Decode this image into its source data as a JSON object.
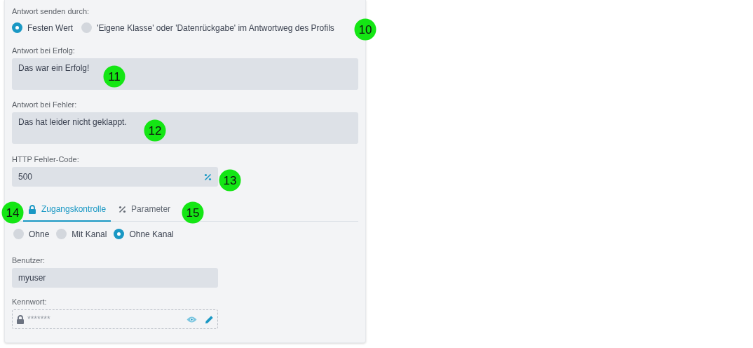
{
  "send_via": {
    "label": "Antwort senden durch:",
    "options": [
      {
        "label": "Festen Wert",
        "selected": true
      },
      {
        "label": "'Eigene Klasse' oder 'Datenrückgabe' im Antwortweg des Profils",
        "selected": false
      }
    ]
  },
  "success": {
    "label": "Antwort bei Erfolg:",
    "value": "Das war ein Erfolg!"
  },
  "error": {
    "label": "Antwort bei Fehler:",
    "value": "Das hat leider nicht geklappt."
  },
  "http_code": {
    "label": "HTTP Fehler-Code:",
    "value": "500"
  },
  "tabs": [
    {
      "label": "Zugangskontrolle",
      "selected": true
    },
    {
      "label": "Parameter",
      "selected": false
    }
  ],
  "access": {
    "options": [
      {
        "label": "Ohne",
        "selected": false
      },
      {
        "label": "Mit Kanal",
        "selected": false
      },
      {
        "label": "Ohne Kanal",
        "selected": true
      }
    ]
  },
  "user": {
    "label": "Benutzer:",
    "value": "myuser"
  },
  "password": {
    "label": "Kennwort:",
    "placeholder": "*******"
  },
  "callouts": [
    "10",
    "11",
    "12",
    "13",
    "14",
    "15"
  ]
}
